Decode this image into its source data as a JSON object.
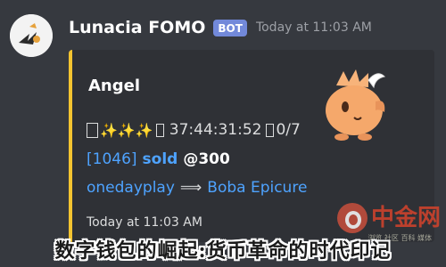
{
  "message": {
    "author": "Lunacia FOMO",
    "badge": "BOT",
    "timestamp": "Today at 11:03 AM"
  },
  "embed": {
    "accent_color": "#f4c430",
    "title": "Angel",
    "line1": {
      "sparkles": "✨✨✨",
      "timer": "37:44:31:52",
      "count": "0/7"
    },
    "line2": {
      "id": "[1046]",
      "action": "sold",
      "price": "@300"
    },
    "line3": {
      "seller": "onedayplay",
      "arrow": "⟹",
      "buyer": "Boba Epicure"
    },
    "footer": "Today at 11:03 AM"
  },
  "watermark": {
    "text": "中金网",
    "sub": "浏览  社区  百科  媒体"
  },
  "caption": "数字钱包的崛起:货币革命的时代印记"
}
